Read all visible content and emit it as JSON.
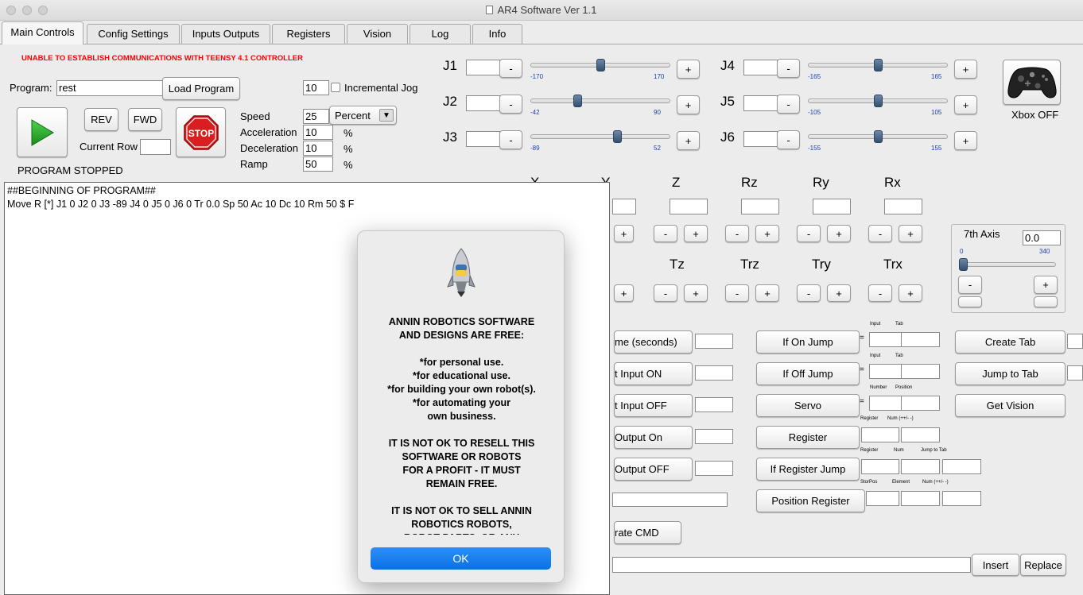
{
  "window": {
    "title": "AR4 Software Ver 1.1"
  },
  "tabs": [
    {
      "label": "Main Controls"
    },
    {
      "label": "Config Settings"
    },
    {
      "label": "Inputs Outputs"
    },
    {
      "label": "Registers"
    },
    {
      "label": "Vision"
    },
    {
      "label": "Log"
    },
    {
      "label": "Info"
    }
  ],
  "status": {
    "alarm": "UNABLE TO ESTABLISH COMMUNICATIONS WITH TEENSY 4.1 CONTROLLER",
    "program_state": "PROGRAM STOPPED",
    "alarm_color": "#ff0000"
  },
  "program": {
    "label": "Program:",
    "name": "rest",
    "load_label": "Load Program",
    "rev_label": "REV",
    "fwd_label": "FWD",
    "stop_label": "STOP",
    "current_row_label": "Current Row",
    "current_row_value": ""
  },
  "jog": {
    "increment_value": "10",
    "incremental_label": "Incremental Jog"
  },
  "motion": {
    "speed_label": "Speed",
    "speed_value": "25",
    "speed_unit": "Percent",
    "accel_label": "Acceleration",
    "accel_value": "10",
    "decel_label": "Deceleration",
    "decel_value": "10",
    "ramp_label": "Ramp",
    "ramp_value": "50",
    "percent": "%"
  },
  "joints": [
    {
      "label": "J1",
      "min": "-170",
      "max": "170",
      "level": 0.5
    },
    {
      "label": "J2",
      "min": "-42",
      "max": "90",
      "level": 0.33
    },
    {
      "label": "J3",
      "min": "-89",
      "max": "52",
      "level": 0.63
    },
    {
      "label": "J4",
      "min": "-165",
      "max": "165",
      "level": 0.5
    },
    {
      "label": "J5",
      "min": "-105",
      "max": "105",
      "level": 0.5
    },
    {
      "label": "J6",
      "min": "-155",
      "max": "155",
      "level": 0.5
    }
  ],
  "buttons": {
    "minus": "-",
    "plus": "+"
  },
  "xbox": {
    "label": "Xbox OFF"
  },
  "cartesian": {
    "x": "X",
    "y": "Y",
    "z": "Z",
    "rz": "Rz",
    "ry": "Ry",
    "rx": "Rx"
  },
  "tool": {
    "tz": "Tz",
    "trz": "Trz",
    "try": "Try",
    "trx": "Trx"
  },
  "axis7": {
    "label": "7th Axis",
    "value": "0.0",
    "min": "0",
    "max": "340",
    "level": 0.0
  },
  "program_text": [
    "##BEGINNING OF PROGRAM##",
    "Move R [*] J1 0 J2 0 J3 -89 J4 0 J5 0 J6 0 Tr 0.0 Sp 50 Ac 10 Dc 10 Rm 50 $ F"
  ],
  "commands": {
    "wait_time": "me (seconds)",
    "wait_input_on": "t Input ON",
    "wait_input_off": "t Input OFF",
    "output_on": "Output On",
    "output_off": "Output OFF",
    "calc_cmd": "rate CMD",
    "if_on_jump": "If On Jump",
    "if_off_jump": "If Off Jump",
    "servo": "Servo",
    "register": "Register",
    "if_register_jump": "If Register Jump",
    "position_register": "Position Register",
    "create_tab": "Create Tab",
    "jump_to_tab": "Jump to Tab",
    "get_vision": "Get Vision",
    "insert": "Insert",
    "replace": "Replace",
    "equals": "=",
    "lbl_input": "Input",
    "lbl_tab": "Tab",
    "lbl_number": "Number",
    "lbl_position": "Position",
    "lbl_register": "Register",
    "lbl_num_pm": "Num (++/- -)",
    "lbl_num": "Num",
    "lbl_jump_to_tab": "Jump to Tab",
    "lbl_storpos": "StorPos",
    "lbl_element": "Element"
  },
  "dialog": {
    "text": "ANNIN ROBOTICS SOFTWARE\nAND DESIGNS ARE FREE:\n\n*for personal use.\n*for educational use.\n*for building your own robot(s).\n*for automating your\nown business.\n\nIT IS NOT OK TO RESELL THIS\nSOFTWARE OR ROBOTS\nFOR A PROFIT - IT MUST\nREMAIN FREE.\n\nIT IS NOT OK TO SELL ANNIN\nROBOTICS ROBOTS,\nROBOT PARTS, OR ANY",
    "ok_label": "OK"
  }
}
